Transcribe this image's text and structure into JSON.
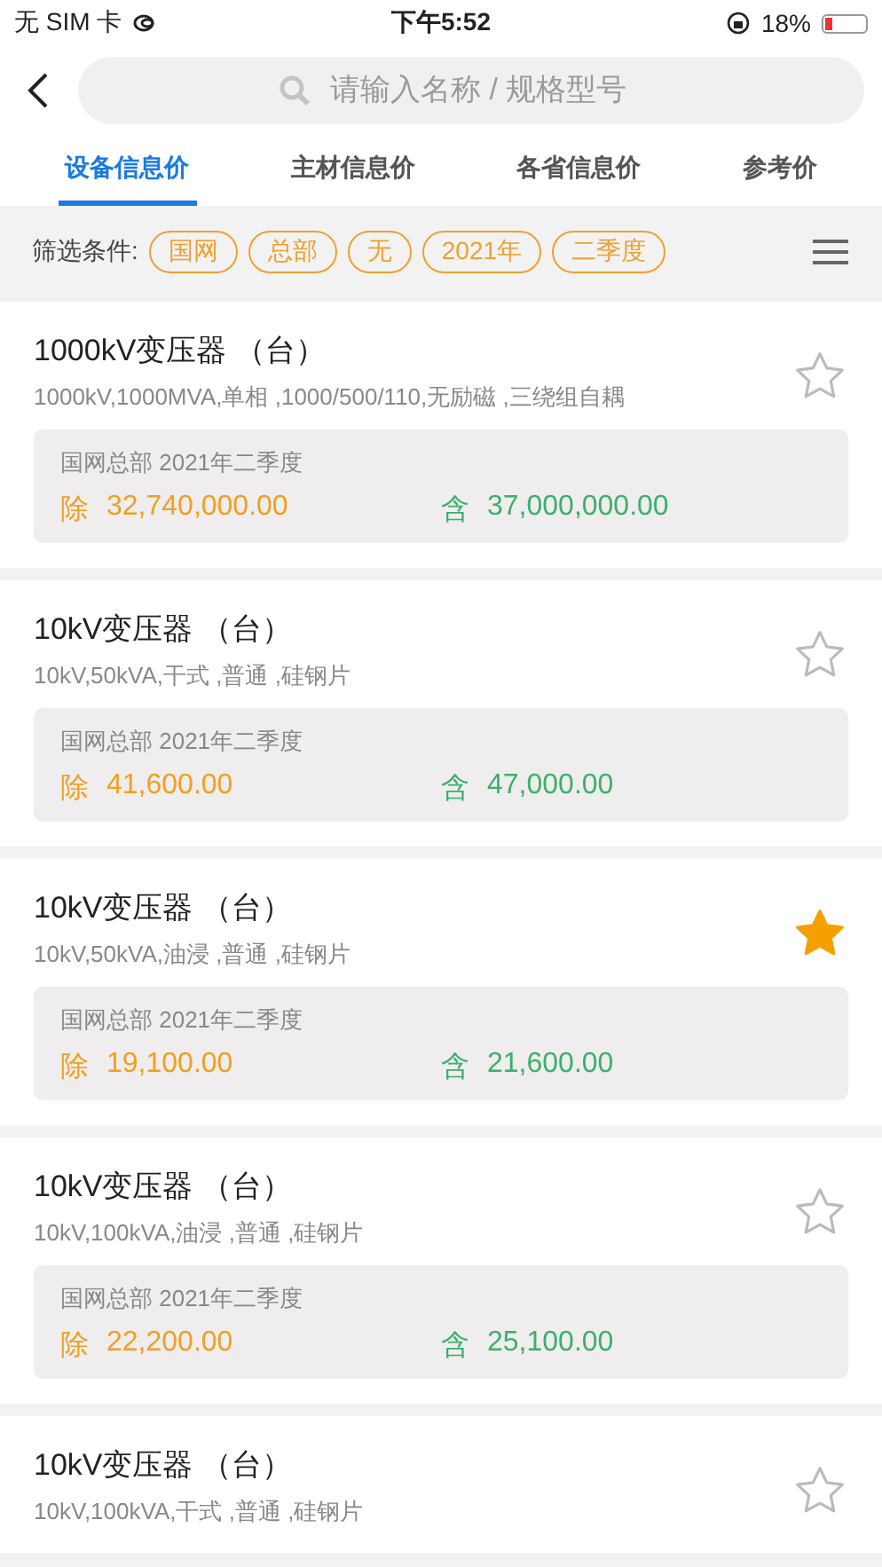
{
  "status_bar": {
    "carrier": "无 SIM 卡",
    "time": "下午5:52",
    "battery": "18%"
  },
  "search": {
    "placeholder": "请输入名称 / 规格型号"
  },
  "tabs": [
    {
      "label": "设备信息价",
      "selected": true
    },
    {
      "label": "主材信息价",
      "selected": false
    },
    {
      "label": "各省信息价",
      "selected": false
    },
    {
      "label": "参考价",
      "selected": false
    }
  ],
  "filter": {
    "label": "筛选条件:",
    "tags": [
      "国网",
      "总部",
      "无",
      "2021年",
      "二季度"
    ]
  },
  "items": [
    {
      "title": "1000kV变压器 （台）",
      "spec": "1000kV,1000MVA,单相 ,1000/500/110,无励磁 ,三绕组自耦",
      "starred": false,
      "region": "国网总部  2021年二季度",
      "excl_label": "除",
      "excl_price": "32,740,000.00",
      "incl_label": "含",
      "incl_price": "37,000,000.00"
    },
    {
      "title": "10kV变压器 （台）",
      "spec": "10kV,50kVA,干式 ,普通 ,硅钢片",
      "starred": false,
      "region": "国网总部  2021年二季度",
      "excl_label": "除",
      "excl_price": "41,600.00",
      "incl_label": "含",
      "incl_price": "47,000.00"
    },
    {
      "title": "10kV变压器 （台）",
      "spec": "10kV,50kVA,油浸 ,普通 ,硅钢片",
      "starred": true,
      "region": "国网总部  2021年二季度",
      "excl_label": "除",
      "excl_price": "19,100.00",
      "incl_label": "含",
      "incl_price": "21,600.00"
    },
    {
      "title": "10kV变压器 （台）",
      "spec": "10kV,100kVA,油浸 ,普通 ,硅钢片",
      "starred": false,
      "region": "国网总部  2021年二季度",
      "excl_label": "除",
      "excl_price": "22,200.00",
      "incl_label": "含",
      "incl_price": "25,100.00"
    },
    {
      "title": "10kV变压器 （台）",
      "spec": "10kV,100kVA,干式 ,普通 ,硅钢片",
      "starred": false
    }
  ]
}
